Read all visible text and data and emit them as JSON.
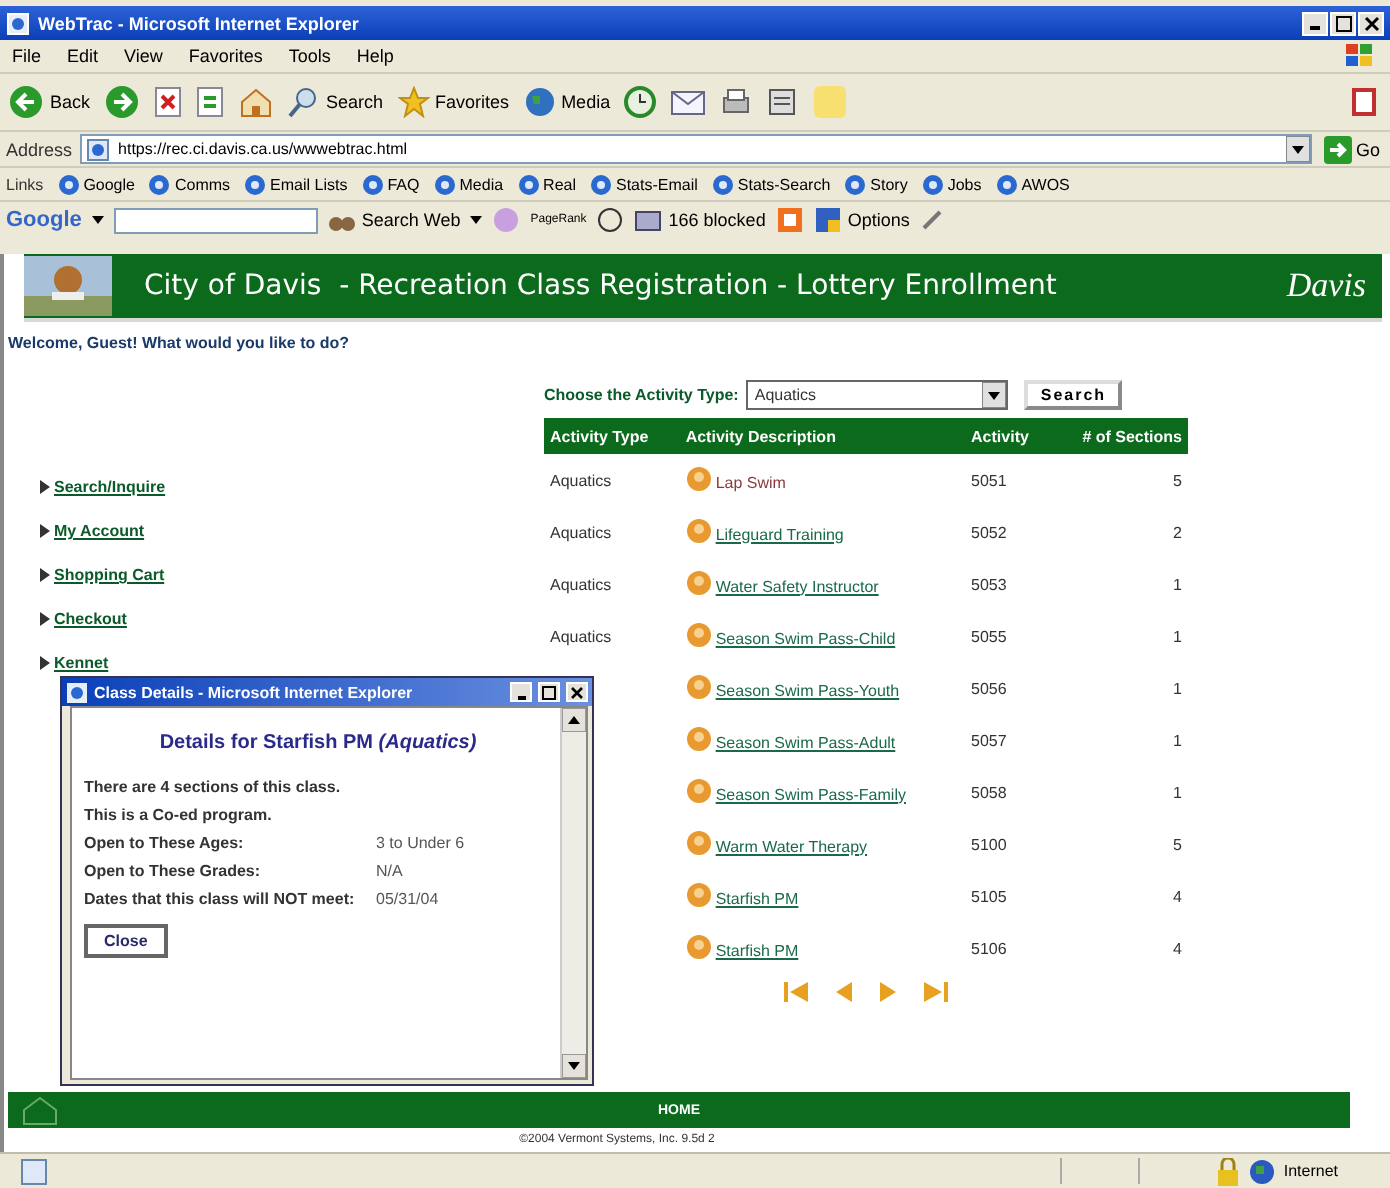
{
  "window": {
    "title": "WebTrac - Microsoft Internet Explorer"
  },
  "menu": [
    "File",
    "Edit",
    "View",
    "Favorites",
    "Tools",
    "Help"
  ],
  "toolbar": {
    "back": "Back",
    "search": "Search",
    "favorites": "Favorites",
    "media": "Media"
  },
  "address": {
    "label": "Address",
    "value": "https://rec.ci.davis.ca.us/wwwebtrac.html",
    "go": "Go"
  },
  "links": {
    "label": "Links",
    "items": [
      "Google",
      "Comms",
      "Email Lists",
      "FAQ",
      "Media",
      "Real",
      "Stats-Email",
      "Stats-Search",
      "Story",
      "Jobs",
      "AWOS"
    ]
  },
  "google_bar": {
    "logo": "Google",
    "search_web": "Search Web",
    "pagerank": "PageRank",
    "blocked": "166 blocked",
    "options": "Options"
  },
  "header": {
    "title": "City of Davis  - Recreation Class Registration - Lottery Enrollment",
    "logo": "Davis"
  },
  "welcome": "Welcome, Guest! What would you like to do?",
  "nav": [
    "Search/Inquire",
    "My Account",
    "Shopping Cart",
    "Checkout",
    "Kennet"
  ],
  "chooser": {
    "label": "Choose the Activity Type:",
    "value": "Aquatics",
    "button": "Search"
  },
  "table": {
    "columns": [
      "Activity Type",
      "Activity Description",
      "Activity",
      "# of Sections"
    ],
    "rows": [
      {
        "type": "Aquatics",
        "description": "Lap Swim",
        "activity": "5051",
        "sections": "5",
        "visited": true
      },
      {
        "type": "Aquatics",
        "description": "Lifeguard Training",
        "activity": "5052",
        "sections": "2",
        "visited": false
      },
      {
        "type": "Aquatics",
        "description": "Water Safety Instructor",
        "activity": "5053",
        "sections": "1",
        "visited": false
      },
      {
        "type": "Aquatics",
        "description": "Season Swim Pass-Child",
        "activity": "5055",
        "sections": "1",
        "visited": false
      },
      {
        "description": "Season Swim Pass-Youth",
        "activity": "5056",
        "sections": "1",
        "visited": false
      },
      {
        "description": "Season Swim Pass-Adult",
        "activity": "5057",
        "sections": "1",
        "visited": false
      },
      {
        "description": "Season Swim Pass-Family",
        "activity": "5058",
        "sections": "1",
        "visited": false
      },
      {
        "description": "Warm Water Therapy",
        "activity": "5100",
        "sections": "5",
        "visited": false
      },
      {
        "description": "Starfish PM",
        "activity": "5105",
        "sections": "4",
        "visited": false
      },
      {
        "description": "Starfish PM",
        "activity": "5106",
        "sections": "4",
        "visited": false
      }
    ]
  },
  "popup": {
    "title": "Class Details - Microsoft Internet Explorer",
    "heading": "Details for Starfish PM *(Aquatics)*",
    "lines": [
      "There are 4 sections of this class.",
      "This is a Co-ed program."
    ],
    "facts": [
      {
        "label": "Open to These Ages:",
        "value": "3 to Under 6"
      },
      {
        "label": "Open to These Grades:",
        "value": "N/A"
      },
      {
        "label": "Dates that this class will NOT meet:",
        "value": "05/31/04"
      }
    ],
    "close": "Close"
  },
  "footer": {
    "home": "HOME",
    "copyright": "©2004 Vermont Systems, Inc.  9.5d 2"
  },
  "status_bar": {
    "zone": "Internet"
  }
}
